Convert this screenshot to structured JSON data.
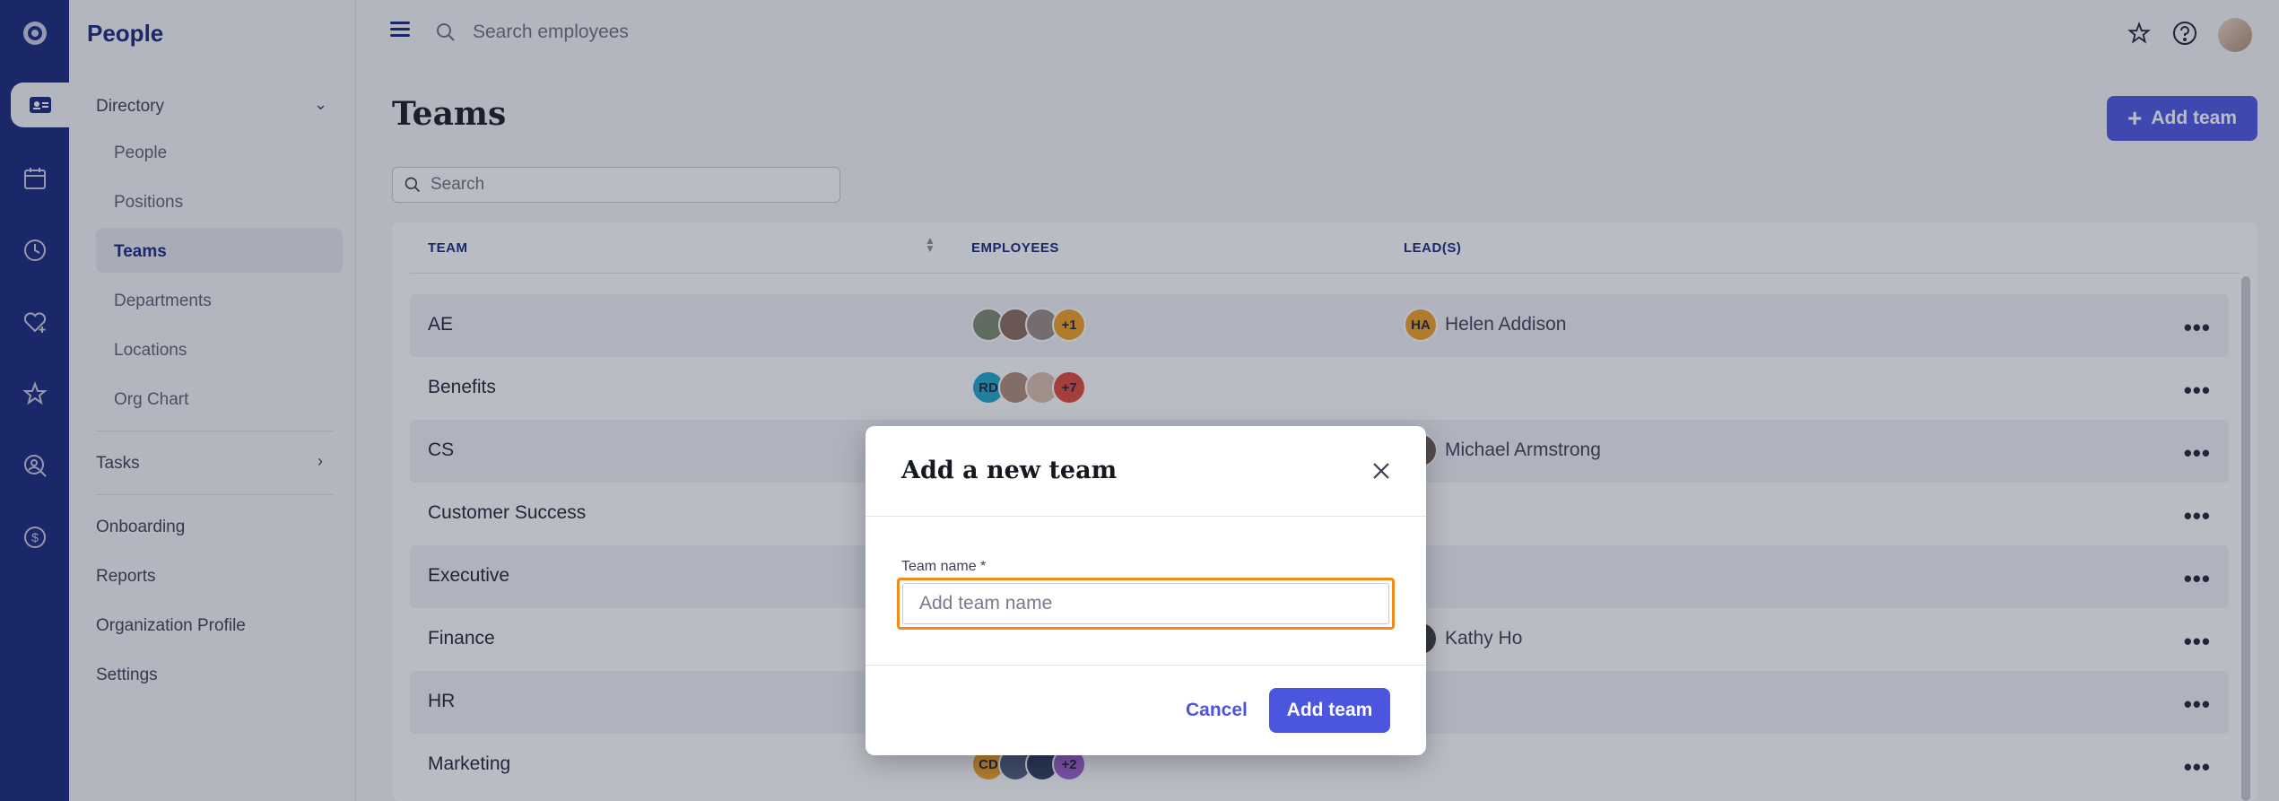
{
  "rail": {
    "items": [
      {
        "name": "home-logo-icon"
      },
      {
        "name": "people-card-icon"
      },
      {
        "name": "calendar-icon"
      },
      {
        "name": "clock-icon"
      },
      {
        "name": "heart-plus-icon"
      },
      {
        "name": "star-icon"
      },
      {
        "name": "search-person-icon"
      },
      {
        "name": "dollar-icon"
      }
    ]
  },
  "sidebar": {
    "title": "People",
    "directory_label": "Directory",
    "sub_items": [
      "People",
      "Positions",
      "Teams",
      "Departments",
      "Locations",
      "Org Chart"
    ],
    "tasks_label": "Tasks",
    "bottom_items": [
      "Onboarding",
      "Reports",
      "Organization Profile",
      "Settings"
    ]
  },
  "topbar": {
    "search_placeholder": "Search employees"
  },
  "main": {
    "title": "Teams",
    "add_team_label": "Add team",
    "search_placeholder": "Search",
    "columns": [
      "TEAM",
      "EMPLOYEES",
      "LEAD(S)"
    ],
    "rows": [
      {
        "name": "AE",
        "avatars": [
          "",
          "",
          ""
        ],
        "extra": "+1",
        "lead_initials": "HA",
        "lead": "Helen Addison"
      },
      {
        "name": "Benefits",
        "avatars": [
          "RD",
          "",
          ""
        ],
        "extra": "+7",
        "lead_initials": "",
        "lead": ""
      },
      {
        "name": "CS",
        "avatars": [],
        "extra": "",
        "lead_initials": "",
        "lead": "Michael Armstrong"
      },
      {
        "name": "Customer Success",
        "avatars": [],
        "extra": "",
        "lead_initials": "",
        "lead": ""
      },
      {
        "name": "Executive",
        "avatars": [],
        "extra": "",
        "lead_initials": "",
        "lead": ""
      },
      {
        "name": "Finance",
        "avatars": [],
        "extra": "",
        "lead_initials": "",
        "lead": "Kathy Ho"
      },
      {
        "name": "HR",
        "avatars": [],
        "extra": "",
        "lead_initials": "",
        "lead": ""
      },
      {
        "name": "Marketing",
        "avatars": [
          "CD",
          "",
          ""
        ],
        "extra": "+2",
        "lead_initials": "",
        "lead": ""
      }
    ]
  },
  "modal": {
    "title": "Add a new team",
    "field_label": "Team name *",
    "field_placeholder": "Add team name",
    "field_value": "",
    "cancel_label": "Cancel",
    "submit_label": "Add team"
  },
  "colors": {
    "rail": "#14247a",
    "accent": "#4b55e0",
    "focus": "#f28a1a"
  }
}
